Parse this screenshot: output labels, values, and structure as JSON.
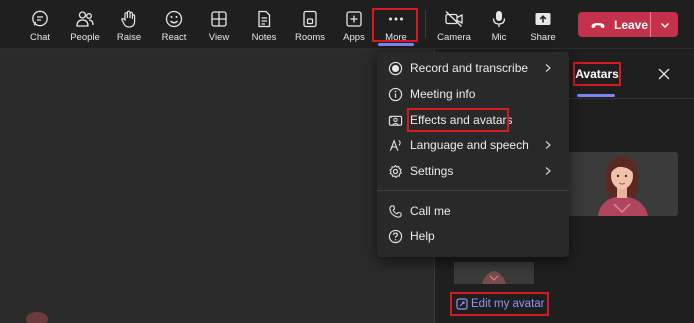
{
  "toolbar": {
    "buttons": [
      {
        "label": "Chat",
        "icon": "chat-icon"
      },
      {
        "label": "People",
        "icon": "people-icon"
      },
      {
        "label": "Raise",
        "icon": "raise-hand-icon"
      },
      {
        "label": "React",
        "icon": "react-smiley-icon"
      },
      {
        "label": "View",
        "icon": "view-grid-icon"
      },
      {
        "label": "Notes",
        "icon": "notes-icon"
      },
      {
        "label": "Rooms",
        "icon": "rooms-icon"
      },
      {
        "label": "Apps",
        "icon": "apps-plus-icon"
      },
      {
        "label": "More",
        "icon": "more-dots-icon"
      },
      {
        "label": "Camera",
        "icon": "camera-off-icon"
      },
      {
        "label": "Mic",
        "icon": "mic-icon"
      },
      {
        "label": "Share",
        "icon": "share-icon"
      }
    ],
    "leave_label": "Leave"
  },
  "menu": {
    "items": [
      {
        "label": "Record and transcribe",
        "icon": "record-icon",
        "has_submenu": true
      },
      {
        "label": "Meeting info",
        "icon": "info-icon",
        "has_submenu": false
      },
      {
        "label": "Effects and avatars",
        "icon": "effects-icon",
        "has_submenu": false
      },
      {
        "label": "Language and speech",
        "icon": "language-icon",
        "has_submenu": true
      },
      {
        "label": "Settings",
        "icon": "settings-gear-icon",
        "has_submenu": true
      },
      {
        "label": "Call me",
        "icon": "phone-icon",
        "has_submenu": false
      },
      {
        "label": "Help",
        "icon": "help-icon",
        "has_submenu": false
      }
    ]
  },
  "panel": {
    "tab_label": "Avatars",
    "edit_label": "Edit my avatar"
  },
  "colors": {
    "accent": "#7f85f5",
    "leave": "#c4314b",
    "highlight_box": "#d71920",
    "link": "#8f94f7"
  }
}
